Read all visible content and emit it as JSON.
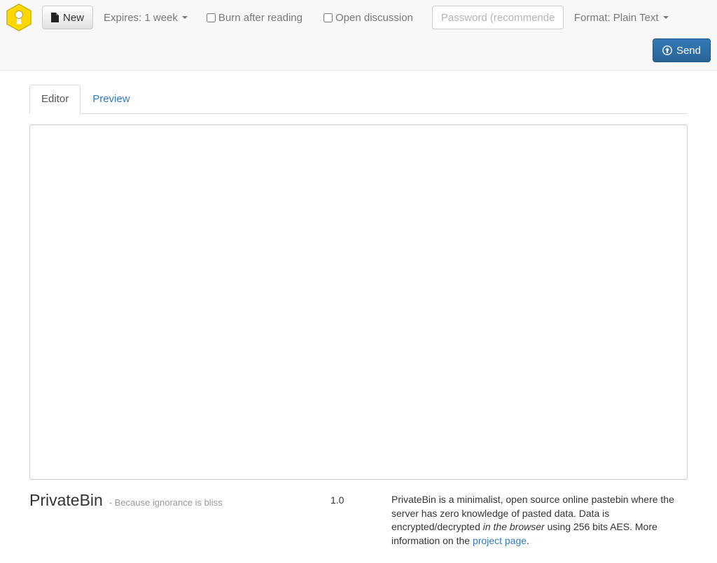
{
  "navbar": {
    "logo_icon": "privatebin-keyhole-hexagon-logo",
    "new_button": {
      "label": "New",
      "icon": "file-icon"
    },
    "expires": {
      "label": "Expires: 1 week",
      "icon": "chevron-down-icon"
    },
    "burn_after_reading": {
      "label": "Burn after reading",
      "checked": false
    },
    "open_discussion": {
      "label": "Open discussion",
      "checked": false
    },
    "password": {
      "value": "",
      "placeholder": "Password (recommended)"
    },
    "format": {
      "label": "Format: Plain Text",
      "icon": "chevron-down-icon"
    },
    "send_button": {
      "label": "Send",
      "icon": "arrow-circle-up-icon"
    }
  },
  "tabs": [
    {
      "label": "Editor",
      "active": true
    },
    {
      "label": "Preview",
      "active": false
    }
  ],
  "editor": {
    "value": "",
    "placeholder": ""
  },
  "footer": {
    "brand_name": "PrivateBin",
    "slogan": "- Because ignorance is bliss",
    "version": "1.0",
    "description_part1": "PrivateBin is a minimalist, open source online pastebin where the server has zero knowledge of pasted data. Data is encrypted/decrypted ",
    "description_italic": "in the browser",
    "description_part2": " using 256 bits AES. More information on the ",
    "project_link": "project page",
    "description_end": "."
  },
  "colors": {
    "navbar_bg": "#f8f8f8",
    "navbar_border": "#e7e7e7",
    "accent_blue": "#337ab7",
    "logo_yellow": "#ffe000",
    "muted_text": "#777777"
  }
}
